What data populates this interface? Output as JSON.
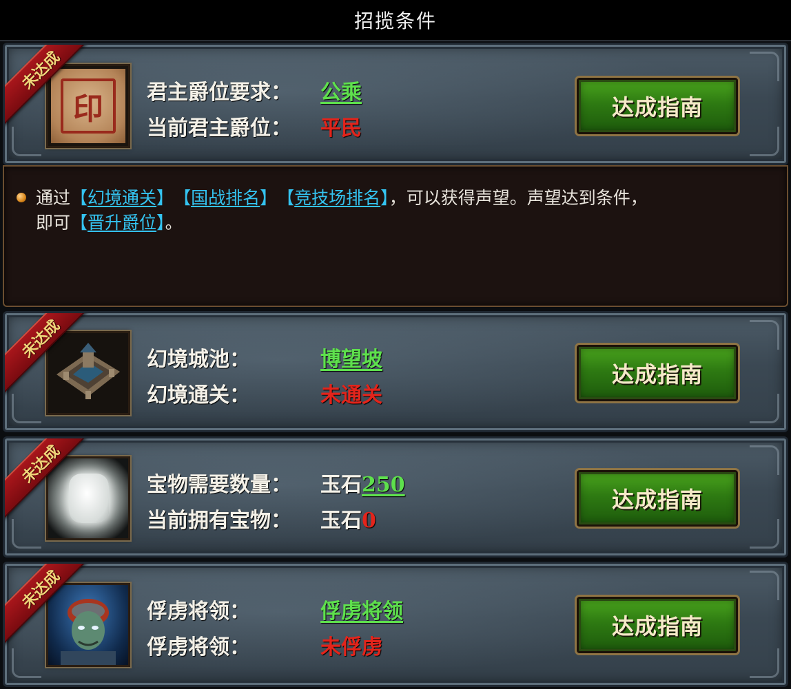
{
  "header": {
    "title": "招揽条件"
  },
  "ribbon_label": "未达成",
  "guide_button_label": "达成指南",
  "cards": [
    {
      "icon": "noble-seal-icon",
      "seal_glyph": "印",
      "row1_label": "君主爵位要求：",
      "row1_value": "公乘",
      "row2_label": "当前君主爵位：",
      "row2_value": "平民"
    },
    {
      "icon": "illusion-city-icon",
      "row1_label": "幻境城池：",
      "row1_value": "博望坡",
      "row2_label": "幻境通关：",
      "row2_value": "未通关"
    },
    {
      "icon": "jade-stone-icon",
      "row1_label": "宝物需要数量：",
      "row1_prefix": "玉石",
      "row1_value": "250",
      "row2_label": "当前拥有宝物：",
      "row2_prefix": "玉石",
      "row2_value": "0"
    },
    {
      "icon": "captive-general-icon",
      "row1_label": "俘虏将领：",
      "row1_value": "俘虏将领",
      "row2_label": "俘虏将领：",
      "row2_value": "未俘虏"
    }
  ],
  "info": {
    "t1": "通过",
    "link1": "幻境通关",
    "link2": "国战排名",
    "link3": "竞技场排名",
    "t2": "，可以获得声望。声望达到条件，",
    "t3": "即可",
    "link4": "晋升爵位",
    "t4": "。"
  },
  "colors": {
    "met": "#5ee04d",
    "unmet": "#e3241b",
    "link": "#34c3f0",
    "button": "#2e7a12",
    "ribbon": "#a8161b"
  }
}
